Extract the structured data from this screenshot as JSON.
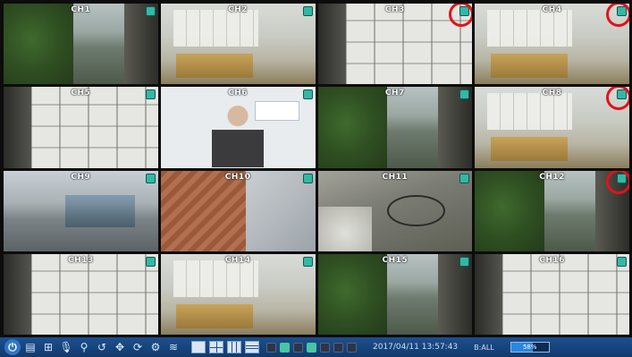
{
  "cameras": [
    {
      "label": "CH1",
      "scene": "street",
      "alert": false
    },
    {
      "label": "CH2",
      "scene": "office",
      "alert": false
    },
    {
      "label": "CH3",
      "scene": "boxes",
      "alert": true
    },
    {
      "label": "CH4",
      "scene": "office",
      "alert": true
    },
    {
      "label": "CH5",
      "scene": "boxes",
      "alert": false
    },
    {
      "label": "CH6",
      "scene": "anchor",
      "alert": false
    },
    {
      "label": "CH7",
      "scene": "street",
      "alert": false
    },
    {
      "label": "CH8",
      "scene": "office",
      "alert": true
    },
    {
      "label": "CH9",
      "scene": "road",
      "alert": false
    },
    {
      "label": "CH10",
      "scene": "bricks",
      "alert": false
    },
    {
      "label": "CH11",
      "scene": "bikes",
      "alert": false
    },
    {
      "label": "CH12",
      "scene": "street",
      "alert": true
    },
    {
      "label": "CH13",
      "scene": "boxes",
      "alert": false
    },
    {
      "label": "CH14",
      "scene": "office",
      "alert": false
    },
    {
      "label": "CH15",
      "scene": "street",
      "alert": false
    },
    {
      "label": "CH16",
      "scene": "boxes",
      "alert": false
    }
  ],
  "toolbar": {
    "buttons": [
      {
        "name": "power-button",
        "icon": "power-icon",
        "glyph": "⏻"
      },
      {
        "name": "menu-button",
        "icon": "menu-icon",
        "glyph": "▤"
      },
      {
        "name": "search-list-button",
        "icon": "list-search-icon",
        "glyph": "⊞"
      },
      {
        "name": "mic-button",
        "icon": "microphone-icon",
        "glyph": "🎙"
      },
      {
        "name": "zoom-button",
        "icon": "magnifier-icon",
        "glyph": "⚲"
      },
      {
        "name": "playback-button",
        "icon": "playback-icon",
        "glyph": "↺"
      },
      {
        "name": "ptz-button",
        "icon": "ptz-cross-icon",
        "glyph": "✥"
      },
      {
        "name": "sequence-button",
        "icon": "cycle-icon",
        "glyph": "⟳"
      },
      {
        "name": "network-button",
        "icon": "network-icon",
        "glyph": "⚙"
      },
      {
        "name": "audio-button",
        "icon": "audio-wave-icon",
        "glyph": "≋"
      }
    ],
    "layouts": [
      "l1",
      "l4",
      "l9",
      "l16"
    ],
    "status_icons": [
      "dim",
      "on",
      "dim",
      "on",
      "dim",
      "dim",
      "dim"
    ],
    "datetime": "2017/04/11 13:57:43",
    "mode": "B:ALL",
    "hdd_percent": 58,
    "hdd_text": "58%"
  },
  "colors": {
    "toolbar_top": "#1d4f8f",
    "alert_ring": "#e2121b",
    "status_ok": "#35b7a6"
  }
}
